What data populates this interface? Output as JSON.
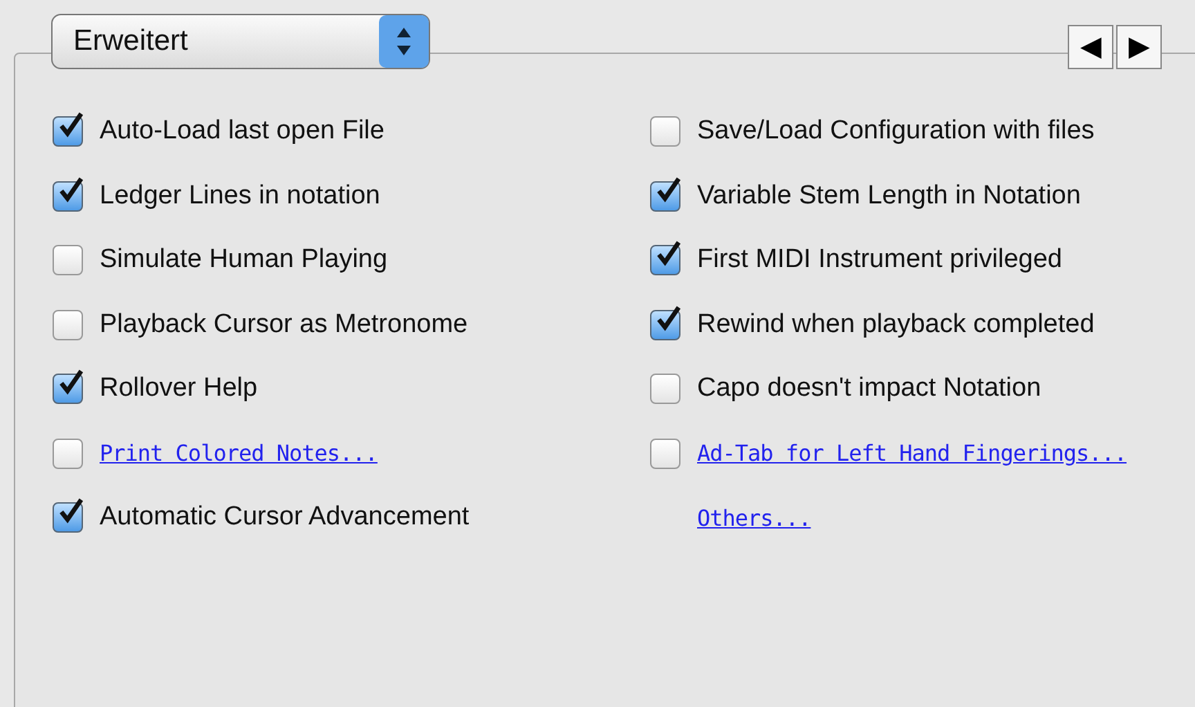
{
  "popup": {
    "value": "Erweitert"
  },
  "nav": {
    "prev": "◀",
    "next": "▶"
  },
  "columns": [
    [
      {
        "kind": "checkbox",
        "label": "Auto-Load last open File",
        "checked": true
      },
      {
        "kind": "checkbox",
        "label": "Ledger Lines in notation",
        "checked": true
      },
      {
        "kind": "checkbox",
        "label": "Simulate Human Playing",
        "checked": false
      },
      {
        "kind": "checkbox",
        "label": "Playback Cursor as Metronome",
        "checked": false
      },
      {
        "kind": "checkbox",
        "label": "Rollover Help",
        "checked": true
      },
      {
        "kind": "link",
        "label": "Print Colored Notes...",
        "checked": false
      },
      {
        "kind": "checkbox",
        "label": "Automatic Cursor Advancement",
        "checked": true
      }
    ],
    [
      {
        "kind": "checkbox",
        "label": "Save/Load Configuration with files",
        "checked": false
      },
      {
        "kind": "checkbox",
        "label": "Variable Stem Length in Notation",
        "checked": true
      },
      {
        "kind": "checkbox",
        "label": "First MIDI Instrument privileged",
        "checked": true
      },
      {
        "kind": "checkbox",
        "label": "Rewind when playback completed",
        "checked": true
      },
      {
        "kind": "checkbox",
        "label": "Capo doesn't impact Notation",
        "checked": false
      },
      {
        "kind": "link",
        "label": "Ad-Tab for Left Hand Fingerings...",
        "checked": false
      },
      {
        "kind": "linkonly",
        "label": "Others..."
      }
    ]
  ]
}
